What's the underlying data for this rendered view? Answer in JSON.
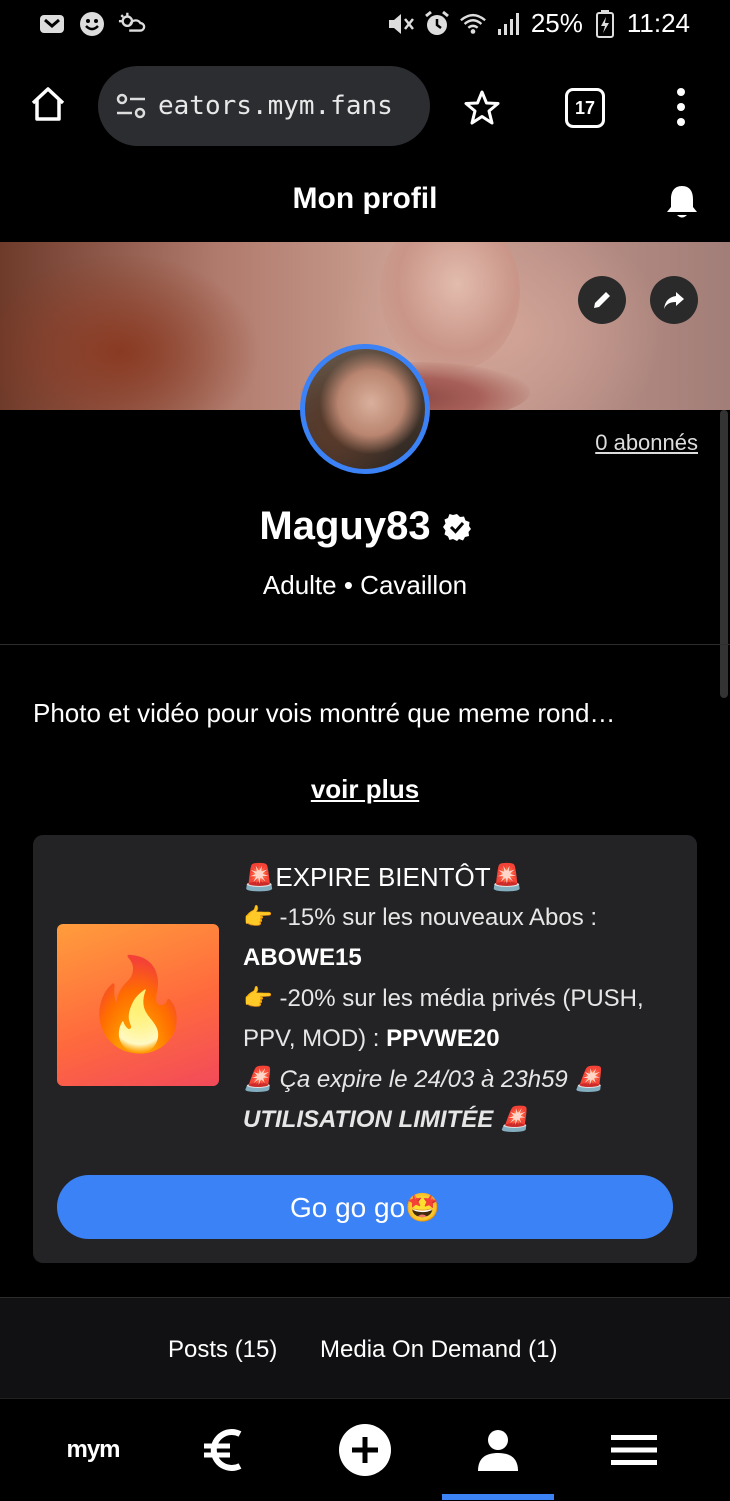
{
  "status_bar": {
    "battery": "25%",
    "time": "11:24",
    "icons_left": [
      "notification-icon",
      "smiley-icon",
      "weather-icon"
    ],
    "icons_right": [
      "mute-icon",
      "alarm-icon",
      "wifi-icon",
      "signal-icon",
      "battery-icon"
    ]
  },
  "browser": {
    "url": "eators.mym.fans",
    "tab_count": "17"
  },
  "header": {
    "title": "Mon profil"
  },
  "profile": {
    "subscribers_link": "0 abonnés",
    "username": "Maguy83",
    "meta": "Adulte • Cavaillon",
    "bio": "Photo et vidéo pour vois montré que meme rond…",
    "see_more": "voir plus"
  },
  "promo": {
    "title": "🚨EXPIRE BIENTÔT🚨",
    "line1_prefix": "👉 -15% sur les nouveaux Abos :",
    "line1_code": "ABOWE15",
    "line2_prefix": "👉 -20% sur les média privés (PUSH, PPV, MOD) :",
    "line2_code": "PPVWE20",
    "line3": "🚨 Ça expire le 24/03 à 23h59 🚨",
    "line4": "UTILISATION LIMITÉE 🚨",
    "image_glyph": "🔥",
    "button_label": "Go go go🤩"
  },
  "tabs": [
    {
      "label": "Posts (15)"
    },
    {
      "label": "Media On Demand (1)"
    }
  ],
  "bottom_nav": {
    "logo": "mym",
    "items": [
      "euro-icon",
      "plus-icon",
      "profile-icon",
      "menu-icon"
    ],
    "active": "profile-icon"
  },
  "colors": {
    "accent": "#3b82f6",
    "background": "#000000",
    "card": "#232325"
  }
}
